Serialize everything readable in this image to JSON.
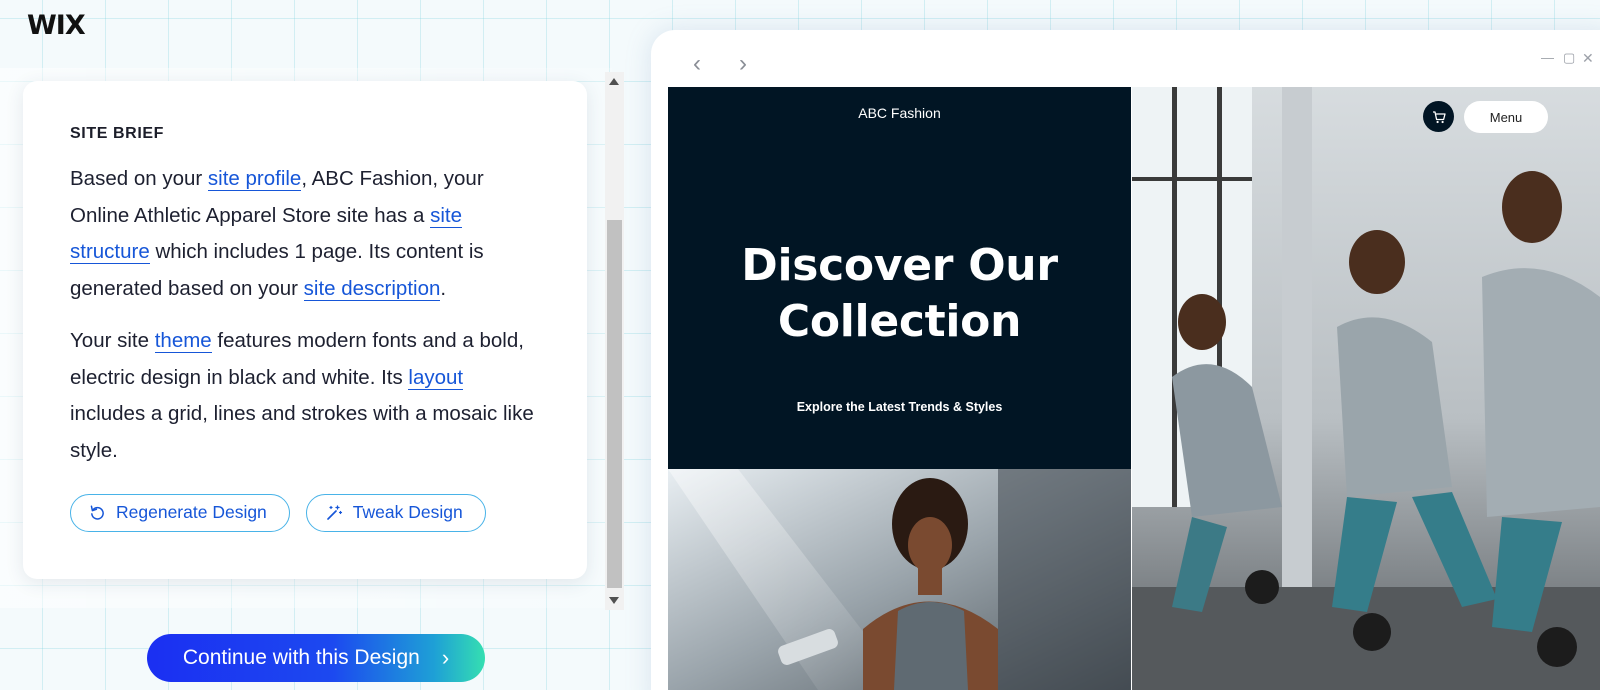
{
  "app": {
    "logo_text": "WIX"
  },
  "brief": {
    "title": "SITE BRIEF",
    "paragraph1": {
      "t1": "Based on your ",
      "link_profile": "site profile",
      "t2": ", ABC Fashion, your Online Athletic Apparel Store site has a ",
      "link_structure": "site structure",
      "t3": " which includes 1 page. Its content is generated based on your ",
      "link_description": "site description",
      "t4": "."
    },
    "paragraph2": {
      "t1": "Your site ",
      "link_theme": "theme",
      "t2": " features modern fonts and a bold, electric design in black and white. Its ",
      "link_layout": "layout",
      "t3": " includes a grid, lines and strokes with a mosaic like style."
    },
    "regenerate_label": "Regenerate Design",
    "tweak_label": "Tweak Design"
  },
  "continue_label": "Continue with this Design",
  "preview": {
    "brand": "ABC Fashion",
    "hero_line1": "Discover Our",
    "hero_line2": "Collection",
    "subtitle": "Explore the Latest Trends & Styles",
    "menu_label": "Menu"
  },
  "icons": {
    "back": "chevron-left-icon",
    "forward": "chevron-right-icon",
    "minimize": "minimize-icon",
    "maximize": "maximize-icon",
    "close": "close-icon",
    "cart": "cart-icon",
    "regenerate": "refresh-icon",
    "tweak": "magic-wand-icon",
    "continue": "chevron-right-icon"
  },
  "colors": {
    "link": "#1656d8",
    "pill_border": "#49b3e8",
    "hero_bg": "#011524",
    "continue_gradient_start": "#1b2ff2",
    "continue_gradient_end": "#35dfb1"
  }
}
